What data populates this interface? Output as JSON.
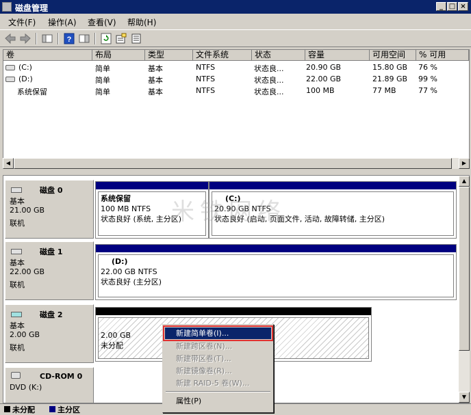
{
  "window": {
    "title": "磁盘管理"
  },
  "menu": [
    "文件(F)",
    "操作(A)",
    "查看(V)",
    "帮助(H)"
  ],
  "list": {
    "columns": [
      "卷",
      "布局",
      "类型",
      "文件系统",
      "状态",
      "容量",
      "可用空间",
      "% 可用"
    ],
    "rows": [
      [
        "(C:)",
        "简单",
        "基本",
        "NTFS",
        "状态良...",
        "20.90 GB",
        "15.80 GB",
        "76 %"
      ],
      [
        "(D:)",
        "简单",
        "基本",
        "NTFS",
        "状态良...",
        "22.00 GB",
        "21.89 GB",
        "99 %"
      ],
      [
        "系统保留",
        "简单",
        "基本",
        "NTFS",
        "状态良...",
        "100 MB",
        "77 MB",
        "77 %"
      ]
    ]
  },
  "disks": [
    {
      "name": "磁盘 0",
      "type": "基本",
      "size": "21.00 GB",
      "status": "联机",
      "partitions": [
        {
          "name": "系统保留",
          "size": "100 MB NTFS",
          "status": "状态良好 (系统, 主分区)"
        },
        {
          "name": "(C:)",
          "size": "20.90 GB NTFS",
          "status": "状态良好 (启动, 页面文件, 活动, 故障转储, 主分区)"
        }
      ]
    },
    {
      "name": "磁盘 1",
      "type": "基本",
      "size": "22.00 GB",
      "status": "联机",
      "partitions": [
        {
          "name": "(D:)",
          "size": "22.00 GB NTFS",
          "status": "状态良好 (主分区)"
        }
      ]
    },
    {
      "name": "磁盘 2",
      "type": "基本",
      "size": "2.00 GB",
      "status": "联机",
      "partitions": [
        {
          "size": "2.00 GB",
          "status": "未分配"
        }
      ]
    },
    {
      "name": "CD-ROM 0",
      "type": "DVD (K:)"
    }
  ],
  "context_menu": {
    "items": [
      "新建简单卷(I)...",
      "新建跨区卷(N)...",
      "新建带区卷(T)...",
      "新建镜像卷(R)...",
      "新建 RAID-5 卷(W)...",
      "属性(P)"
    ]
  },
  "legend": {
    "unallocated": "未分配",
    "primary": "主分区"
  },
  "watermark": "米铁网络",
  "colors": {
    "titlebar": "#0a246a",
    "primary_partition": "#000080",
    "selection": "#0a246a",
    "highlight_box": "#e03030"
  }
}
